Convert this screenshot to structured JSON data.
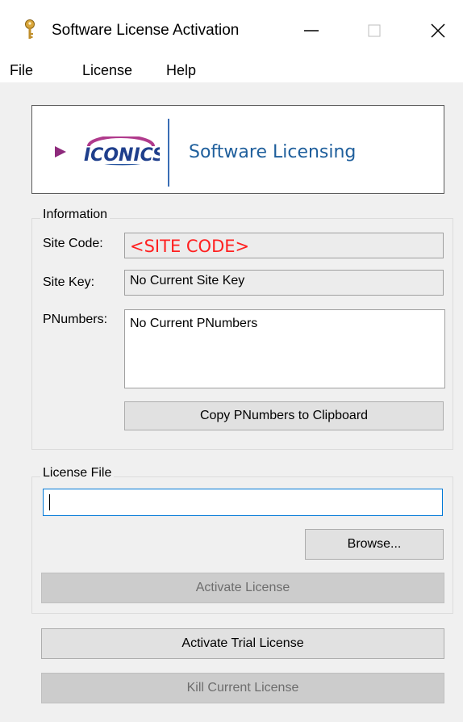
{
  "window": {
    "title": "Software License Activation",
    "icon": "key-icon"
  },
  "menu": {
    "items": [
      "File",
      "License",
      "Help"
    ]
  },
  "banner": {
    "brand": "ICONICS",
    "title": "Software Licensing"
  },
  "information": {
    "legend": "Information",
    "site_code_label": "Site Code:",
    "site_code_value": "<SITE CODE>",
    "site_key_label": "Site Key:",
    "site_key_value": "No Current Site Key",
    "pnumbers_label": "PNumbers:",
    "pnumbers_value": "No Current PNumbers",
    "copy_button": "Copy PNumbers to Clipboard"
  },
  "license_file": {
    "legend": "License File",
    "value": "",
    "browse_button": "Browse...",
    "activate_button": "Activate License"
  },
  "actions": {
    "trial_button": "Activate Trial License",
    "kill_button": "Kill Current License"
  },
  "colors": {
    "accent": "#0078d7",
    "site_code": "#ff2020",
    "brand_blue": "#1f5f9c"
  }
}
